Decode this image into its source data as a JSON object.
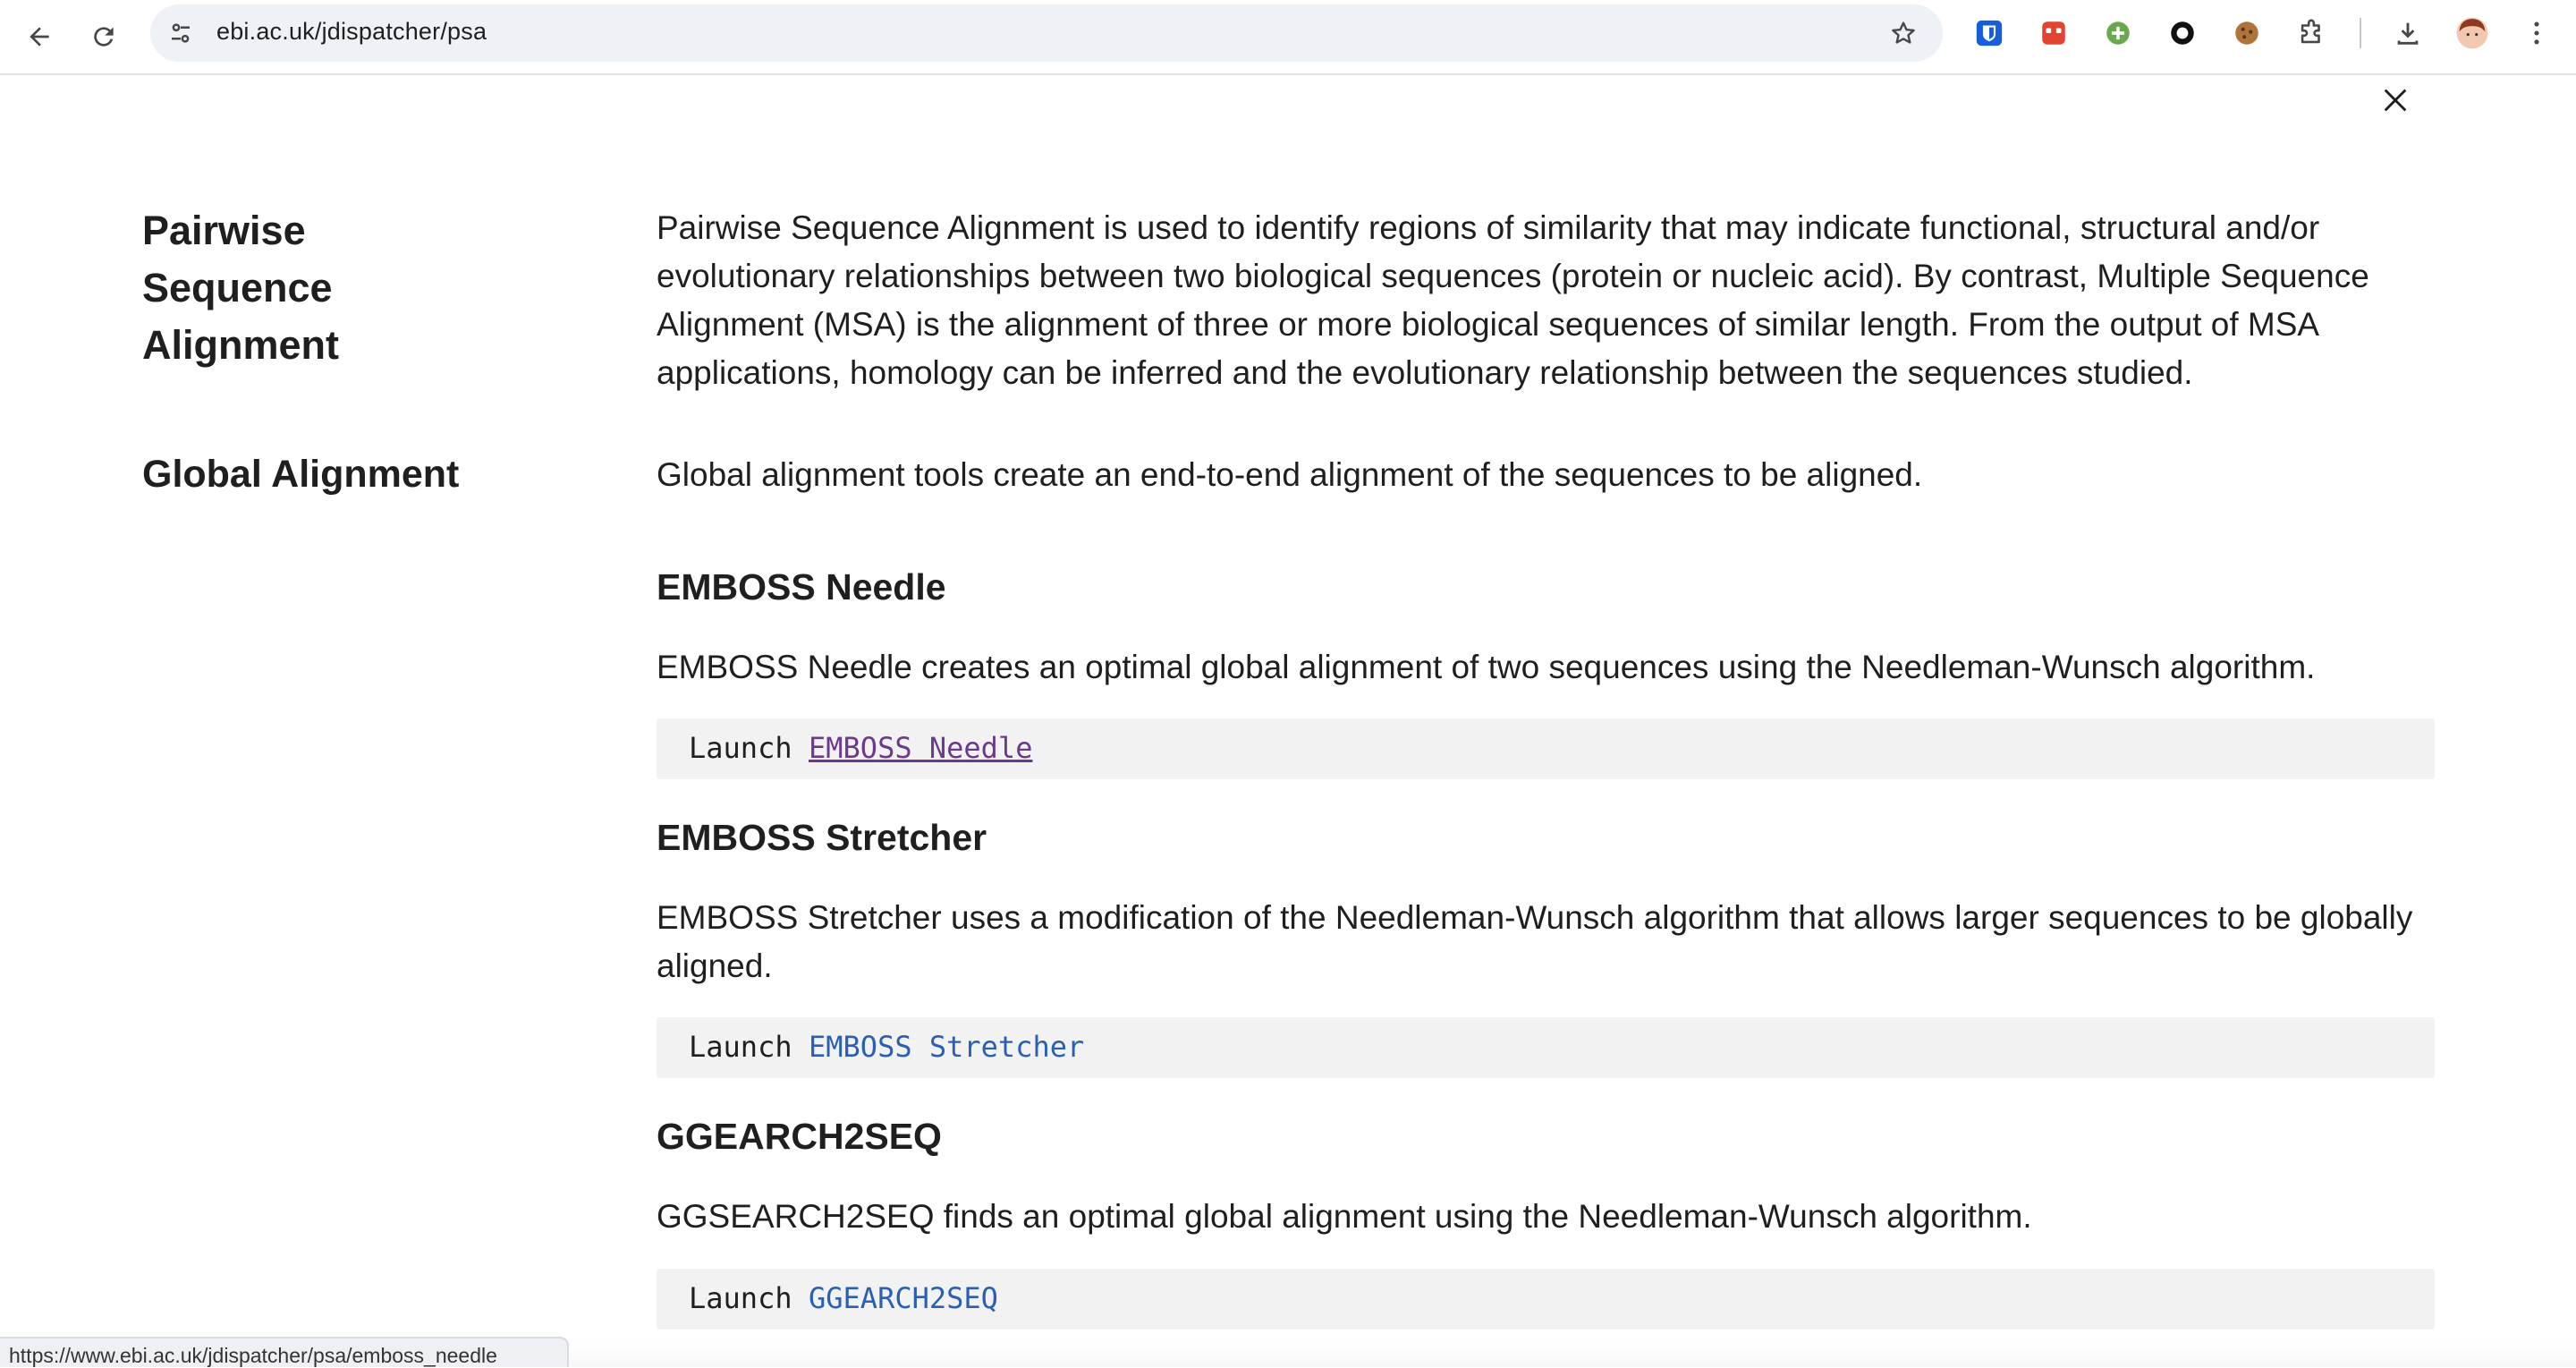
{
  "browser": {
    "url": "ebi.ac.uk/jdispatcher/psa",
    "status_url": "https://www.ebi.ac.uk/jdispatcher/psa/emboss_needle",
    "icons": {
      "back": "back-arrow-icon",
      "reload": "reload-icon",
      "site_info": "tune-icon",
      "bookmark": "star-icon",
      "extensions": [
        "bitwarden-icon",
        "todoist-icon",
        "green-plus-icon",
        "circle-icon",
        "cookie-icon",
        "puzzle-extensions-icon"
      ],
      "download": "download-icon",
      "profile": "avatar",
      "menu": "kebab-menu-icon"
    }
  },
  "page": {
    "close_icon": "close-icon",
    "sections": [
      {
        "heading": "Pairwise Sequence Alignment",
        "text": "Pairwise Sequence Alignment is used to identify regions of similarity that may indicate functional, structural and/or evolutionary relationships between two biological sequences (protein or nucleic acid). By contrast, Multiple Sequence Alignment (MSA) is the alignment of three or more biological sequences of similar length. From the output of MSA applications, homology can be inferred and the evolutionary relationship between the sequences studied."
      },
      {
        "heading": "Global Alignment",
        "text": "Global alignment tools create an end-to-end alignment of the sequences to be aligned."
      }
    ],
    "tools": [
      {
        "title": "EMBOSS Needle",
        "description": "EMBOSS Needle creates an optimal global alignment of two sequences using the Needleman-Wunsch algorithm.",
        "launch_prefix": "Launch",
        "launch_link": "EMBOSS Needle"
      },
      {
        "title": "EMBOSS Stretcher",
        "description": "EMBOSS Stretcher uses a modification of the Needleman-Wunsch algorithm that allows larger sequences to be globally aligned.",
        "launch_prefix": "Launch",
        "launch_link": "EMBOSS Stretcher"
      },
      {
        "title": "GGEARCH2SEQ",
        "description": "GGSEARCH2SEQ finds an optimal global alignment using the Needleman-Wunsch algorithm.",
        "launch_prefix": "Launch",
        "launch_link": "GGEARCH2SEQ"
      }
    ]
  },
  "colors": {
    "link": "#2b5fb3",
    "visited_link": "#6a3a8c",
    "code_bg": "#f2f2f2",
    "omnibox_bg": "#eef1f6"
  }
}
